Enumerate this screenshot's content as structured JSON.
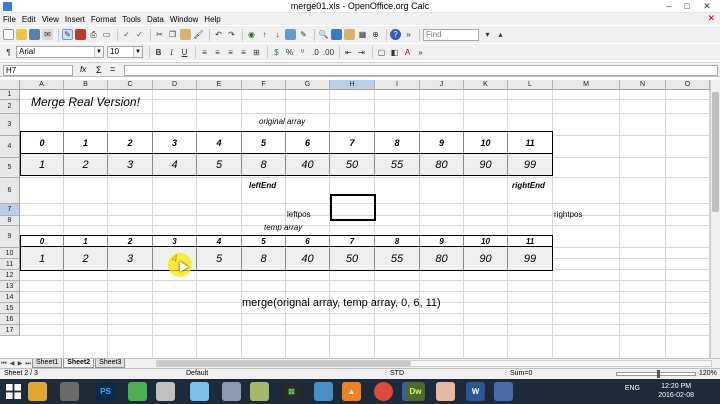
{
  "window": {
    "title": "merge01.xls - OpenOffice.org Calc"
  },
  "menu": [
    "File",
    "Edit",
    "View",
    "Insert",
    "Format",
    "Tools",
    "Data",
    "Window",
    "Help"
  ],
  "toolbar": {
    "font_name": "Arial",
    "font_size": "10",
    "find_placeholder": "Find",
    "bold": "B",
    "italic": "I",
    "underline": "U"
  },
  "formula_bar": {
    "cell_ref": "H7",
    "fx": "fx",
    "sum": "Σ",
    "equals": "=",
    "content": ""
  },
  "columns": [
    "A",
    "B",
    "C",
    "D",
    "E",
    "F",
    "G",
    "H",
    "I",
    "J",
    "K",
    "L",
    "M",
    "N",
    "O"
  ],
  "selected_column": "H",
  "rows": [
    "1",
    "2",
    "3",
    "4",
    "5",
    "6",
    "7",
    "8",
    "9",
    "10",
    "11",
    "12",
    "13",
    "14",
    "15",
    "16",
    "17"
  ],
  "selected_row": "7",
  "sheet": {
    "title": "Merge Real Version!",
    "original_label": "original array",
    "index_row": [
      "0",
      "1",
      "2",
      "3",
      "4",
      "5",
      "6",
      "7",
      "8",
      "9",
      "10",
      "11"
    ],
    "original_values": [
      "1",
      "2",
      "3",
      "4",
      "5",
      "8",
      "40",
      "50",
      "55",
      "80",
      "90",
      "99"
    ],
    "left_end": "leftEnd",
    "right_end": "rightEnd",
    "left_pos": "leftpos",
    "right_pos": "rightpos",
    "temp_label": "temp array",
    "temp_index_row": [
      "0",
      "1",
      "2",
      "3",
      "4",
      "5",
      "6",
      "7",
      "8",
      "9",
      "10",
      "11"
    ],
    "temp_values": [
      "1",
      "2",
      "3",
      "4",
      "5",
      "8",
      "40",
      "50",
      "55",
      "80",
      "90",
      "99"
    ],
    "call": "merge(orignal array, temp array, 0, 6, 11)"
  },
  "sheet_tabs": [
    "Sheet1",
    "Sheet2",
    "Sheet3"
  ],
  "active_tab": "Sheet2",
  "status": {
    "sheet": "Sheet 2 / 3",
    "style": "Default",
    "mode": "STD",
    "sum": "Sum=0",
    "zoom": "120%"
  },
  "taskbar": {
    "apps": [
      "PS",
      "Dw",
      "W"
    ],
    "lang": "ENG",
    "time": "12:20 PM",
    "date": "2016-02-08"
  },
  "colors": {
    "accent": "#b9cfe9",
    "cell_fill": "#efefef",
    "taskbar": "#1c2a3a",
    "highlight": "#ffe600"
  }
}
